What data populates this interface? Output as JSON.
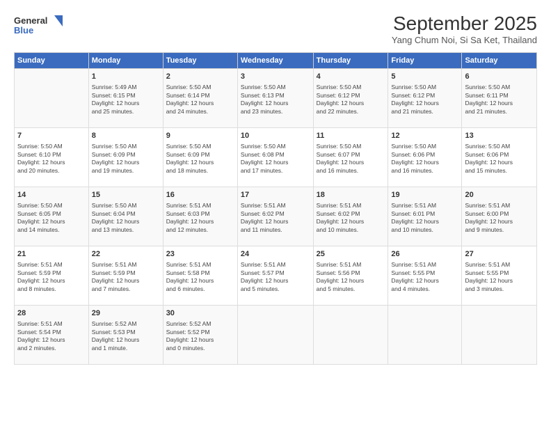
{
  "header": {
    "logo_line1": "General",
    "logo_line2": "Blue",
    "title": "September 2025",
    "subtitle": "Yang Chum Noi, Si Sa Ket, Thailand"
  },
  "weekdays": [
    "Sunday",
    "Monday",
    "Tuesday",
    "Wednesday",
    "Thursday",
    "Friday",
    "Saturday"
  ],
  "weeks": [
    [
      {
        "day": "",
        "info": []
      },
      {
        "day": "1",
        "info": [
          "Sunrise: 5:49 AM",
          "Sunset: 6:15 PM",
          "Daylight: 12 hours",
          "and 25 minutes."
        ]
      },
      {
        "day": "2",
        "info": [
          "Sunrise: 5:50 AM",
          "Sunset: 6:14 PM",
          "Daylight: 12 hours",
          "and 24 minutes."
        ]
      },
      {
        "day": "3",
        "info": [
          "Sunrise: 5:50 AM",
          "Sunset: 6:13 PM",
          "Daylight: 12 hours",
          "and 23 minutes."
        ]
      },
      {
        "day": "4",
        "info": [
          "Sunrise: 5:50 AM",
          "Sunset: 6:12 PM",
          "Daylight: 12 hours",
          "and 22 minutes."
        ]
      },
      {
        "day": "5",
        "info": [
          "Sunrise: 5:50 AM",
          "Sunset: 6:12 PM",
          "Daylight: 12 hours",
          "and 21 minutes."
        ]
      },
      {
        "day": "6",
        "info": [
          "Sunrise: 5:50 AM",
          "Sunset: 6:11 PM",
          "Daylight: 12 hours",
          "and 21 minutes."
        ]
      }
    ],
    [
      {
        "day": "7",
        "info": [
          "Sunrise: 5:50 AM",
          "Sunset: 6:10 PM",
          "Daylight: 12 hours",
          "and 20 minutes."
        ]
      },
      {
        "day": "8",
        "info": [
          "Sunrise: 5:50 AM",
          "Sunset: 6:09 PM",
          "Daylight: 12 hours",
          "and 19 minutes."
        ]
      },
      {
        "day": "9",
        "info": [
          "Sunrise: 5:50 AM",
          "Sunset: 6:09 PM",
          "Daylight: 12 hours",
          "and 18 minutes."
        ]
      },
      {
        "day": "10",
        "info": [
          "Sunrise: 5:50 AM",
          "Sunset: 6:08 PM",
          "Daylight: 12 hours",
          "and 17 minutes."
        ]
      },
      {
        "day": "11",
        "info": [
          "Sunrise: 5:50 AM",
          "Sunset: 6:07 PM",
          "Daylight: 12 hours",
          "and 16 minutes."
        ]
      },
      {
        "day": "12",
        "info": [
          "Sunrise: 5:50 AM",
          "Sunset: 6:06 PM",
          "Daylight: 12 hours",
          "and 16 minutes."
        ]
      },
      {
        "day": "13",
        "info": [
          "Sunrise: 5:50 AM",
          "Sunset: 6:06 PM",
          "Daylight: 12 hours",
          "and 15 minutes."
        ]
      }
    ],
    [
      {
        "day": "14",
        "info": [
          "Sunrise: 5:50 AM",
          "Sunset: 6:05 PM",
          "Daylight: 12 hours",
          "and 14 minutes."
        ]
      },
      {
        "day": "15",
        "info": [
          "Sunrise: 5:50 AM",
          "Sunset: 6:04 PM",
          "Daylight: 12 hours",
          "and 13 minutes."
        ]
      },
      {
        "day": "16",
        "info": [
          "Sunrise: 5:51 AM",
          "Sunset: 6:03 PM",
          "Daylight: 12 hours",
          "and 12 minutes."
        ]
      },
      {
        "day": "17",
        "info": [
          "Sunrise: 5:51 AM",
          "Sunset: 6:02 PM",
          "Daylight: 12 hours",
          "and 11 minutes."
        ]
      },
      {
        "day": "18",
        "info": [
          "Sunrise: 5:51 AM",
          "Sunset: 6:02 PM",
          "Daylight: 12 hours",
          "and 10 minutes."
        ]
      },
      {
        "day": "19",
        "info": [
          "Sunrise: 5:51 AM",
          "Sunset: 6:01 PM",
          "Daylight: 12 hours",
          "and 10 minutes."
        ]
      },
      {
        "day": "20",
        "info": [
          "Sunrise: 5:51 AM",
          "Sunset: 6:00 PM",
          "Daylight: 12 hours",
          "and 9 minutes."
        ]
      }
    ],
    [
      {
        "day": "21",
        "info": [
          "Sunrise: 5:51 AM",
          "Sunset: 5:59 PM",
          "Daylight: 12 hours",
          "and 8 minutes."
        ]
      },
      {
        "day": "22",
        "info": [
          "Sunrise: 5:51 AM",
          "Sunset: 5:59 PM",
          "Daylight: 12 hours",
          "and 7 minutes."
        ]
      },
      {
        "day": "23",
        "info": [
          "Sunrise: 5:51 AM",
          "Sunset: 5:58 PM",
          "Daylight: 12 hours",
          "and 6 minutes."
        ]
      },
      {
        "day": "24",
        "info": [
          "Sunrise: 5:51 AM",
          "Sunset: 5:57 PM",
          "Daylight: 12 hours",
          "and 5 minutes."
        ]
      },
      {
        "day": "25",
        "info": [
          "Sunrise: 5:51 AM",
          "Sunset: 5:56 PM",
          "Daylight: 12 hours",
          "and 5 minutes."
        ]
      },
      {
        "day": "26",
        "info": [
          "Sunrise: 5:51 AM",
          "Sunset: 5:55 PM",
          "Daylight: 12 hours",
          "and 4 minutes."
        ]
      },
      {
        "day": "27",
        "info": [
          "Sunrise: 5:51 AM",
          "Sunset: 5:55 PM",
          "Daylight: 12 hours",
          "and 3 minutes."
        ]
      }
    ],
    [
      {
        "day": "28",
        "info": [
          "Sunrise: 5:51 AM",
          "Sunset: 5:54 PM",
          "Daylight: 12 hours",
          "and 2 minutes."
        ]
      },
      {
        "day": "29",
        "info": [
          "Sunrise: 5:52 AM",
          "Sunset: 5:53 PM",
          "Daylight: 12 hours",
          "and 1 minute."
        ]
      },
      {
        "day": "30",
        "info": [
          "Sunrise: 5:52 AM",
          "Sunset: 5:52 PM",
          "Daylight: 12 hours",
          "and 0 minutes."
        ]
      },
      {
        "day": "",
        "info": []
      },
      {
        "day": "",
        "info": []
      },
      {
        "day": "",
        "info": []
      },
      {
        "day": "",
        "info": []
      }
    ]
  ]
}
